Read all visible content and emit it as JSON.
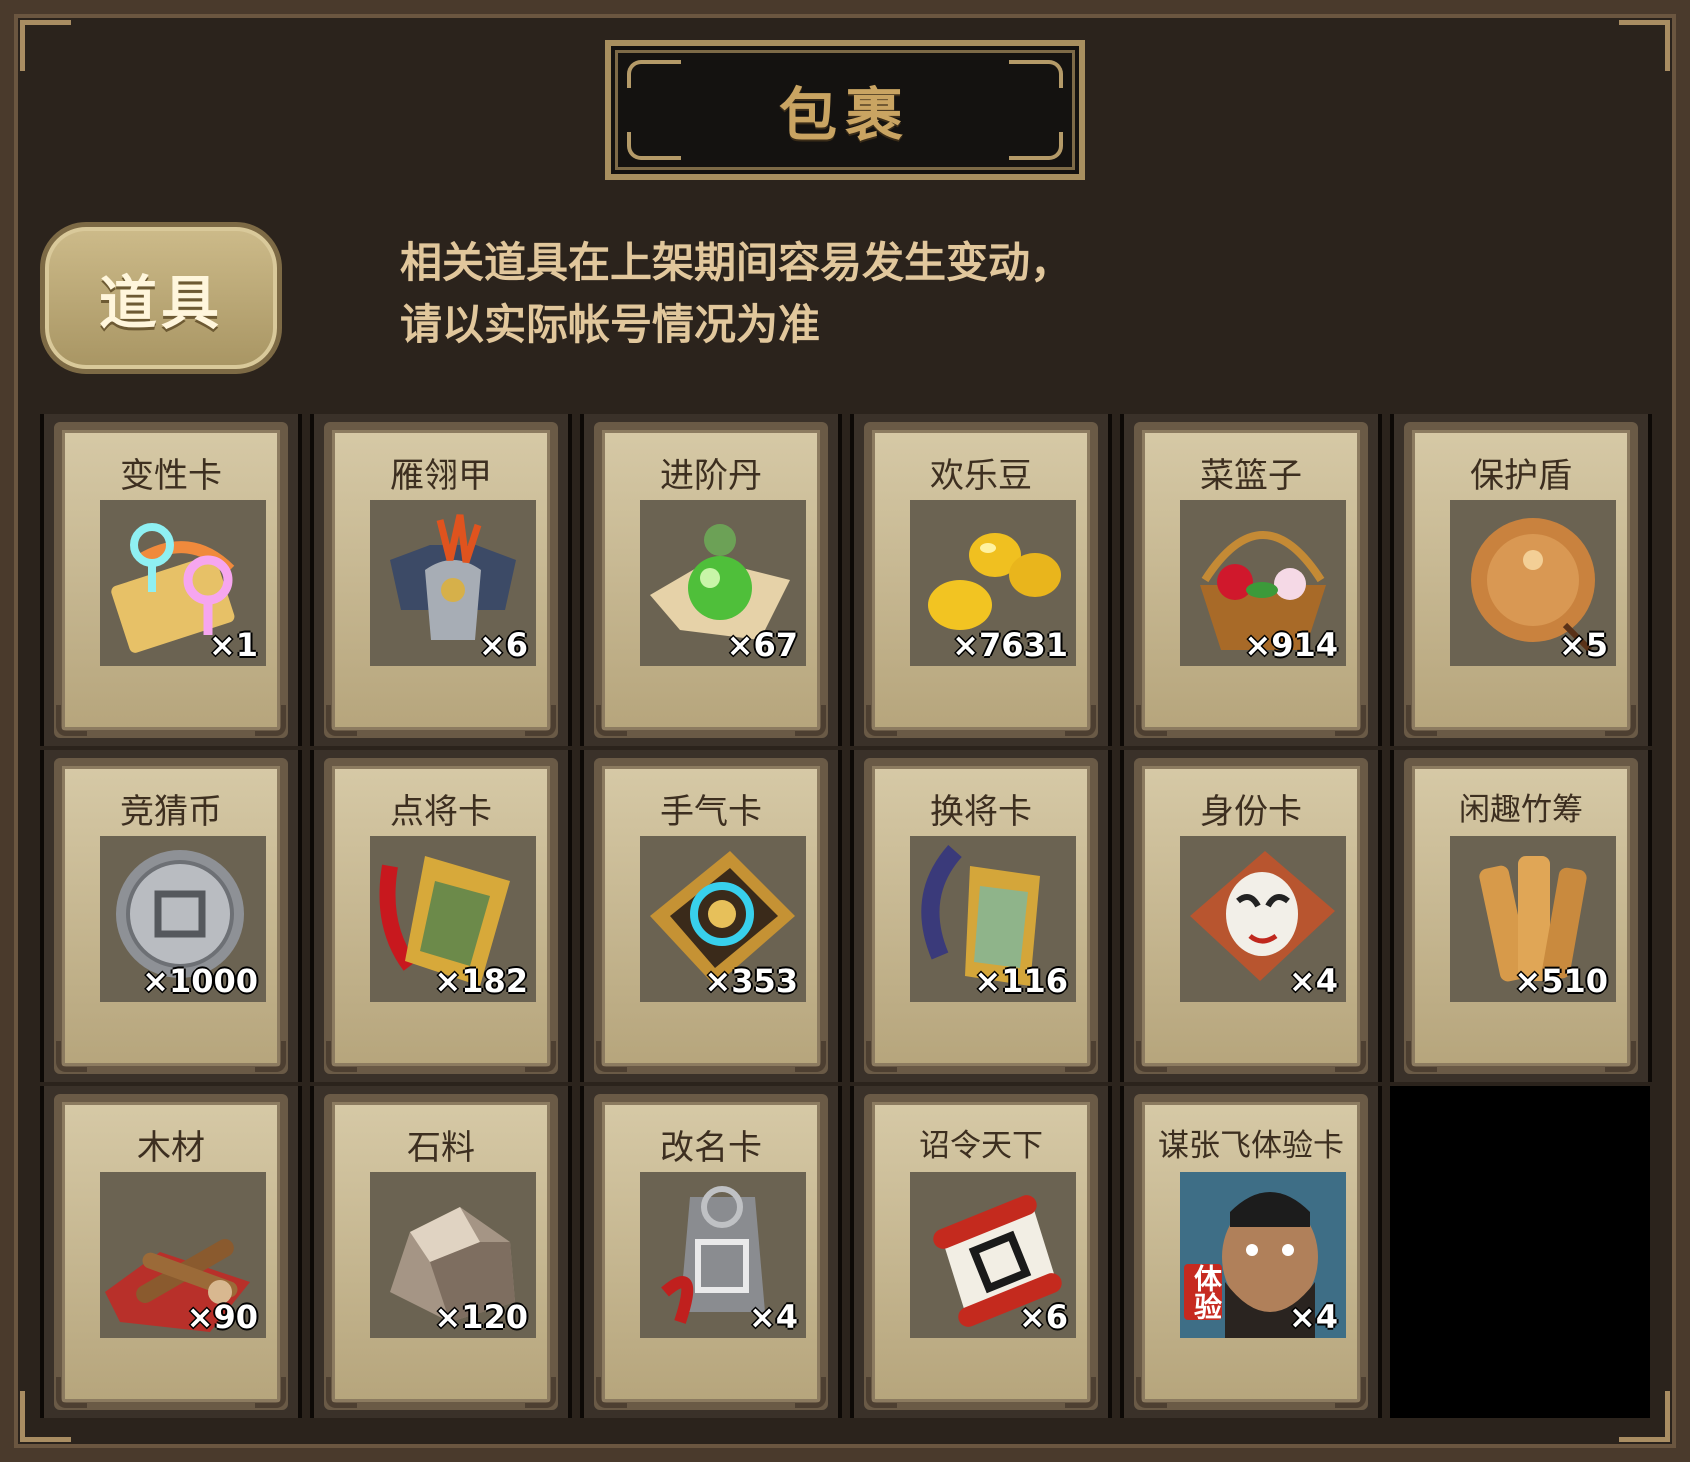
{
  "title": "包裹",
  "tab": {
    "label": "道具"
  },
  "notice": {
    "line1": "相关道具在上架期间容易发生变动，",
    "line2": "请以实际帐号情况为准"
  },
  "items": [
    {
      "name": "变性卡",
      "count": "×1",
      "icon": "gender-swap-card-icon"
    },
    {
      "name": "雁翎甲",
      "count": "×6",
      "icon": "armor-icon"
    },
    {
      "name": "进阶丹",
      "count": "×67",
      "icon": "green-pill-icon"
    },
    {
      "name": "欢乐豆",
      "count": "×7631",
      "icon": "gold-beans-icon"
    },
    {
      "name": "菜篮子",
      "count": "×914",
      "icon": "flower-basket-icon"
    },
    {
      "name": "保护盾",
      "count": "×5",
      "icon": "round-shield-icon"
    },
    {
      "name": "竞猜币",
      "count": "×1000",
      "icon": "silver-coin-icon"
    },
    {
      "name": "点将卡",
      "count": "×182",
      "icon": "general-token-icon"
    },
    {
      "name": "手气卡",
      "count": "×353",
      "icon": "luck-card-icon"
    },
    {
      "name": "换将卡",
      "count": "×116",
      "icon": "swap-token-icon"
    },
    {
      "name": "身份卡",
      "count": "×4",
      "icon": "opera-mask-card-icon"
    },
    {
      "name": "闲趣竹筹",
      "count": "×510",
      "icon": "bamboo-tally-icon"
    },
    {
      "name": "木材",
      "count": "×90",
      "icon": "wood-icon"
    },
    {
      "name": "石料",
      "count": "×120",
      "icon": "stone-icon"
    },
    {
      "name": "改名卡",
      "count": "×4",
      "icon": "name-plate-icon"
    },
    {
      "name": "诏令天下",
      "count": "×6",
      "icon": "imperial-scroll-icon"
    },
    {
      "name": "谋张飞体验卡",
      "count": "×4",
      "icon": "hero-portrait-icon",
      "badge": "体验"
    }
  ]
}
